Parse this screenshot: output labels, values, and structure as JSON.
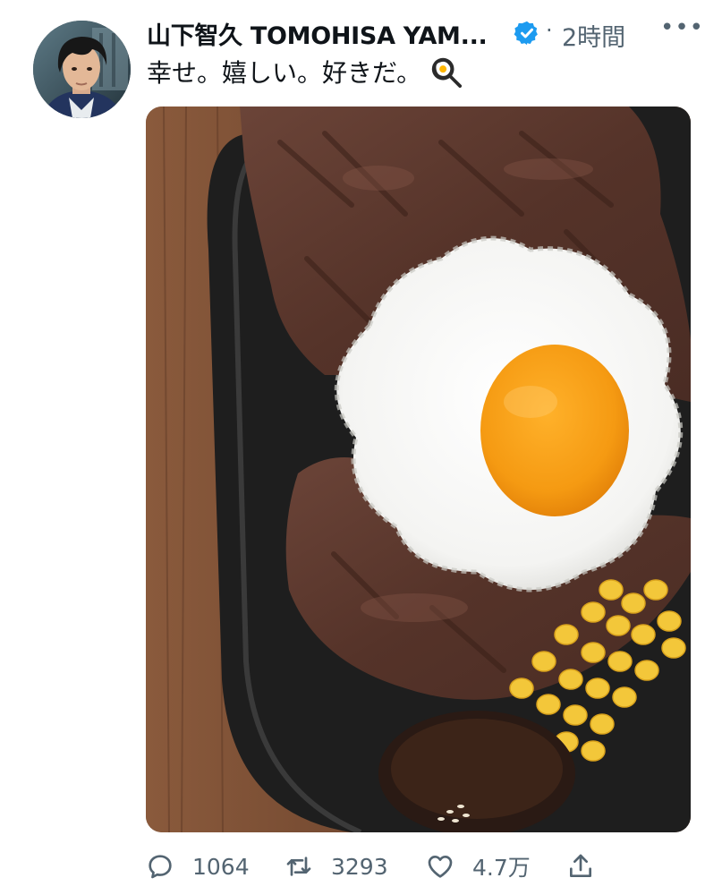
{
  "post": {
    "author_name": "山下智久 TOMOHISA YAM...",
    "verified": true,
    "separator": "·",
    "timestamp": "2時間",
    "more_label": "•••",
    "text": "幸せ。嬉しい。好きだ。",
    "text_emoji": "cooking-egg-icon"
  },
  "media": {
    "content": "steak-with-fried-egg-and-corn-photo"
  },
  "actions": {
    "replies": "1064",
    "reposts": "3293",
    "likes": "4.7万"
  },
  "colors": {
    "text_primary": "#0f1419",
    "text_secondary": "#536471",
    "verified_badge": "#1d9bf0"
  }
}
